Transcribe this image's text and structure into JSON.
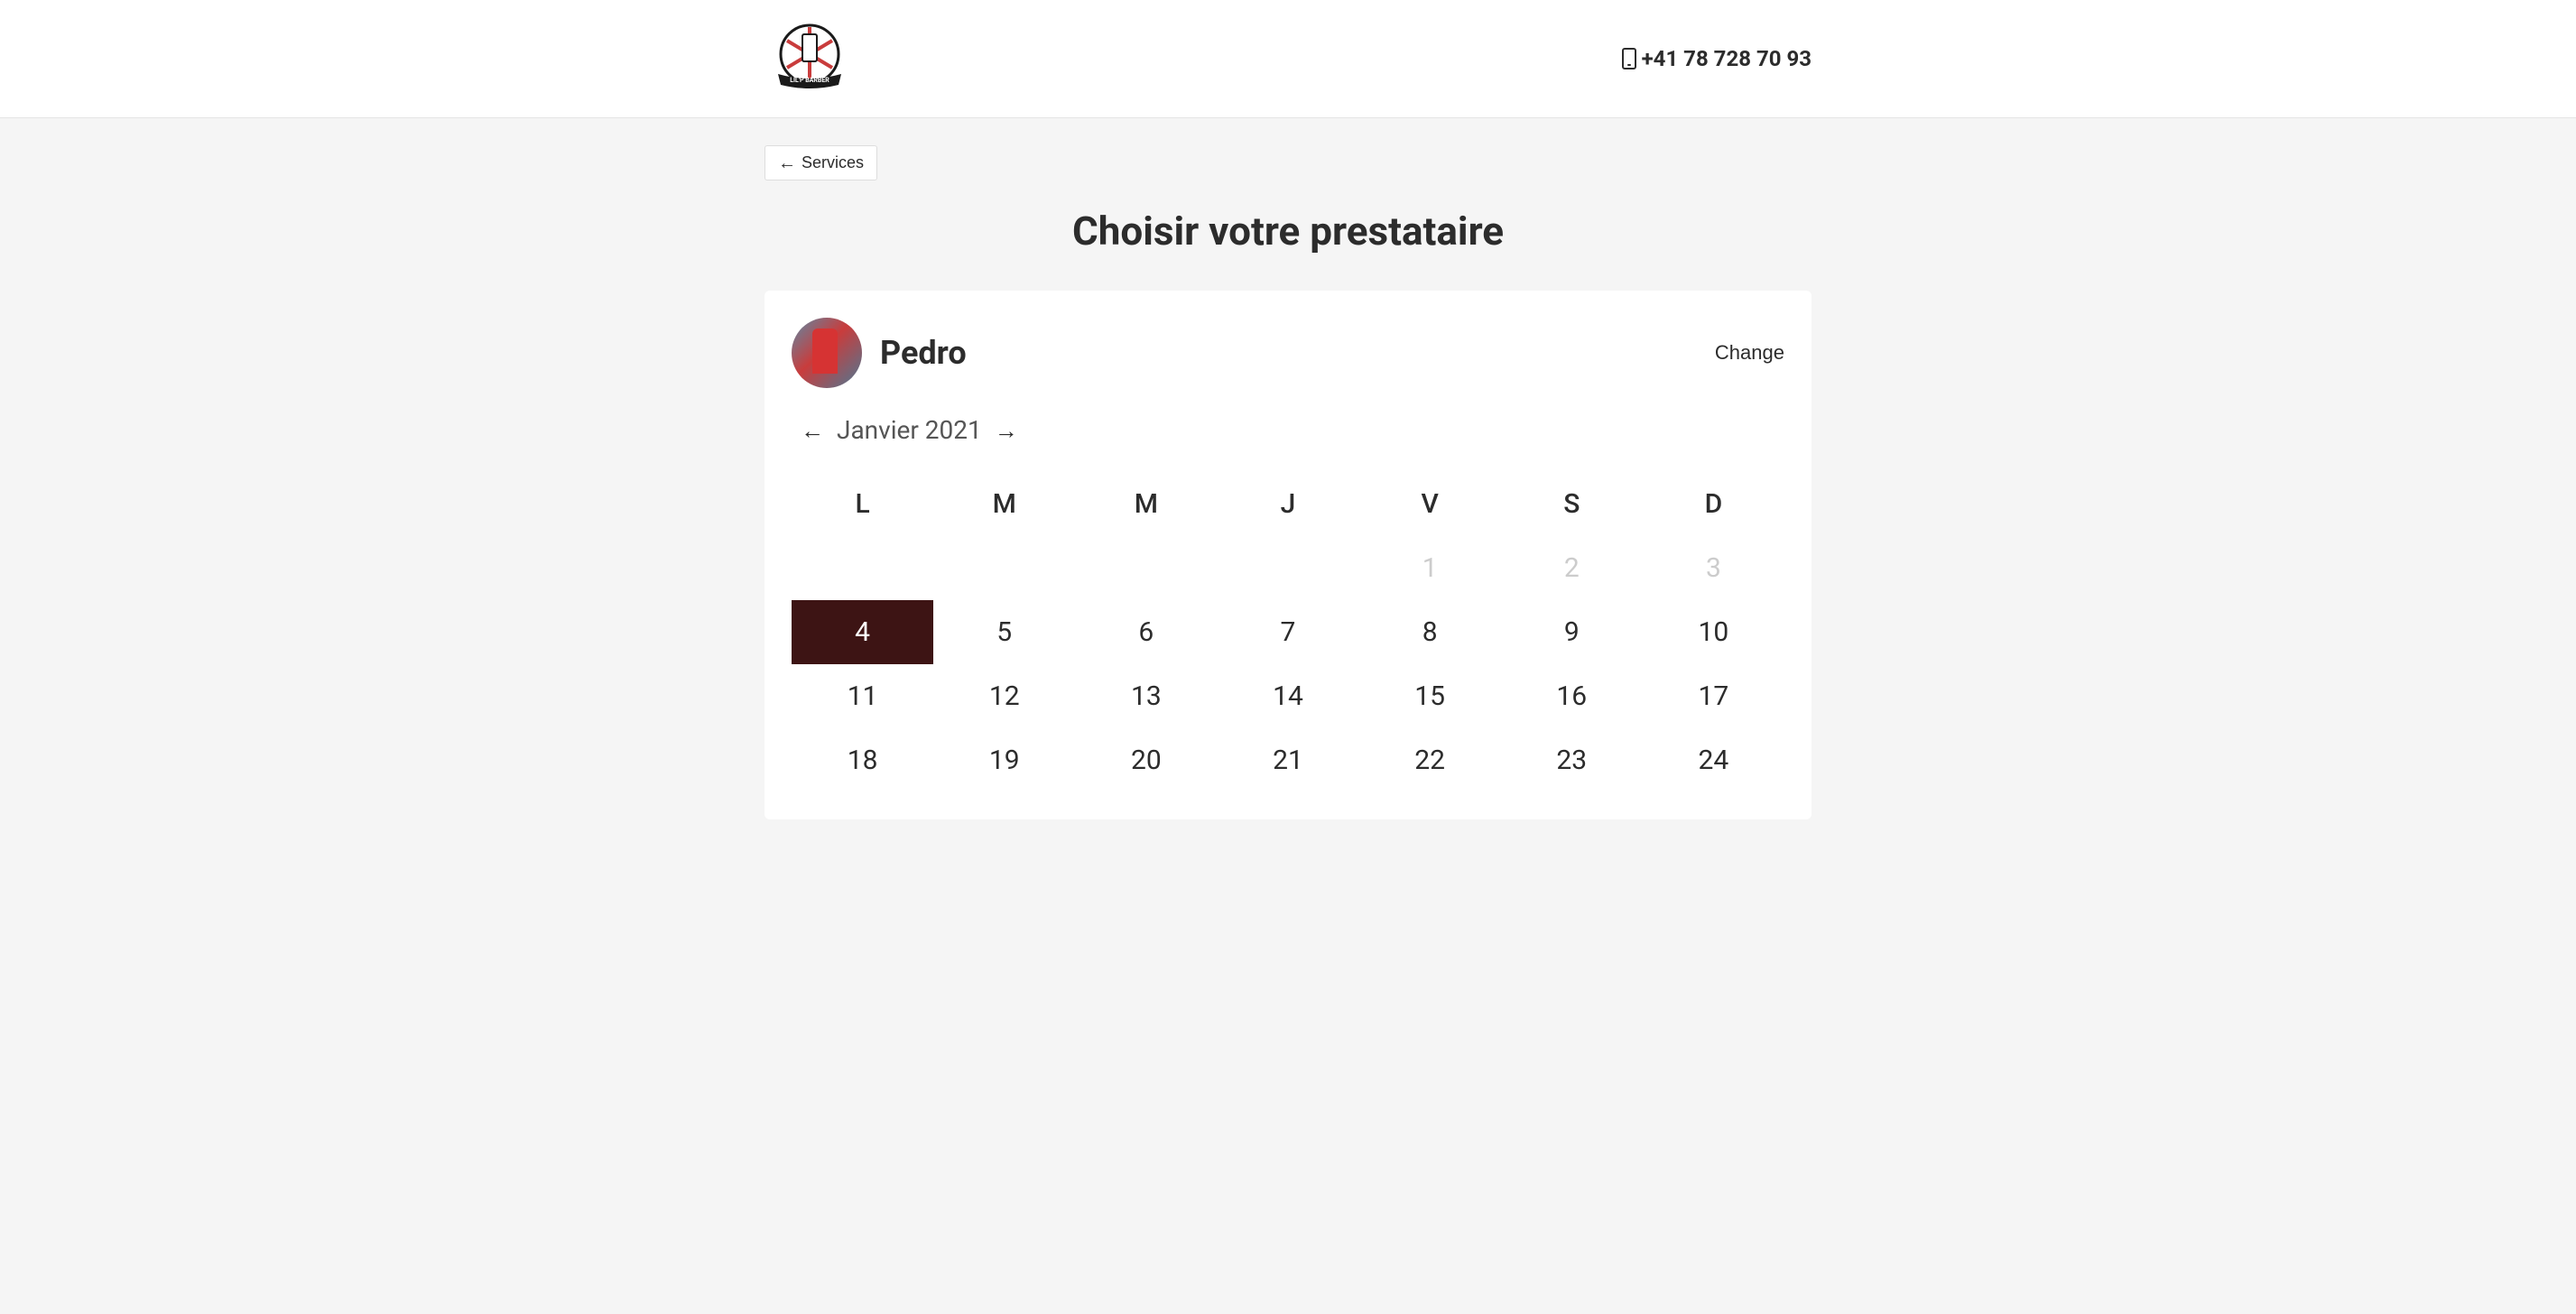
{
  "header": {
    "phone": "+41 78 728 70 93",
    "logo_text": "LIL'P BARBER"
  },
  "nav": {
    "back_label": "Services"
  },
  "page": {
    "title": "Choisir votre prestataire"
  },
  "provider": {
    "name": "Pedro",
    "change_label": "Change"
  },
  "calendar": {
    "month_label": "Janvier 2021",
    "day_headers": [
      "L",
      "M",
      "M",
      "J",
      "V",
      "S",
      "D"
    ],
    "weeks": [
      [
        {
          "day": "",
          "state": "empty"
        },
        {
          "day": "",
          "state": "empty"
        },
        {
          "day": "",
          "state": "empty"
        },
        {
          "day": "",
          "state": "empty"
        },
        {
          "day": "1",
          "state": "disabled"
        },
        {
          "day": "2",
          "state": "disabled"
        },
        {
          "day": "3",
          "state": "disabled"
        }
      ],
      [
        {
          "day": "4",
          "state": "selected"
        },
        {
          "day": "5",
          "state": "active"
        },
        {
          "day": "6",
          "state": "active"
        },
        {
          "day": "7",
          "state": "active"
        },
        {
          "day": "8",
          "state": "active"
        },
        {
          "day": "9",
          "state": "active"
        },
        {
          "day": "10",
          "state": "active"
        }
      ],
      [
        {
          "day": "11",
          "state": "active"
        },
        {
          "day": "12",
          "state": "active"
        },
        {
          "day": "13",
          "state": "active"
        },
        {
          "day": "14",
          "state": "active"
        },
        {
          "day": "15",
          "state": "active"
        },
        {
          "day": "16",
          "state": "active"
        },
        {
          "day": "17",
          "state": "active"
        }
      ],
      [
        {
          "day": "18",
          "state": "active"
        },
        {
          "day": "19",
          "state": "active"
        },
        {
          "day": "20",
          "state": "active"
        },
        {
          "day": "21",
          "state": "active"
        },
        {
          "day": "22",
          "state": "active"
        },
        {
          "day": "23",
          "state": "active"
        },
        {
          "day": "24",
          "state": "active"
        }
      ]
    ]
  }
}
